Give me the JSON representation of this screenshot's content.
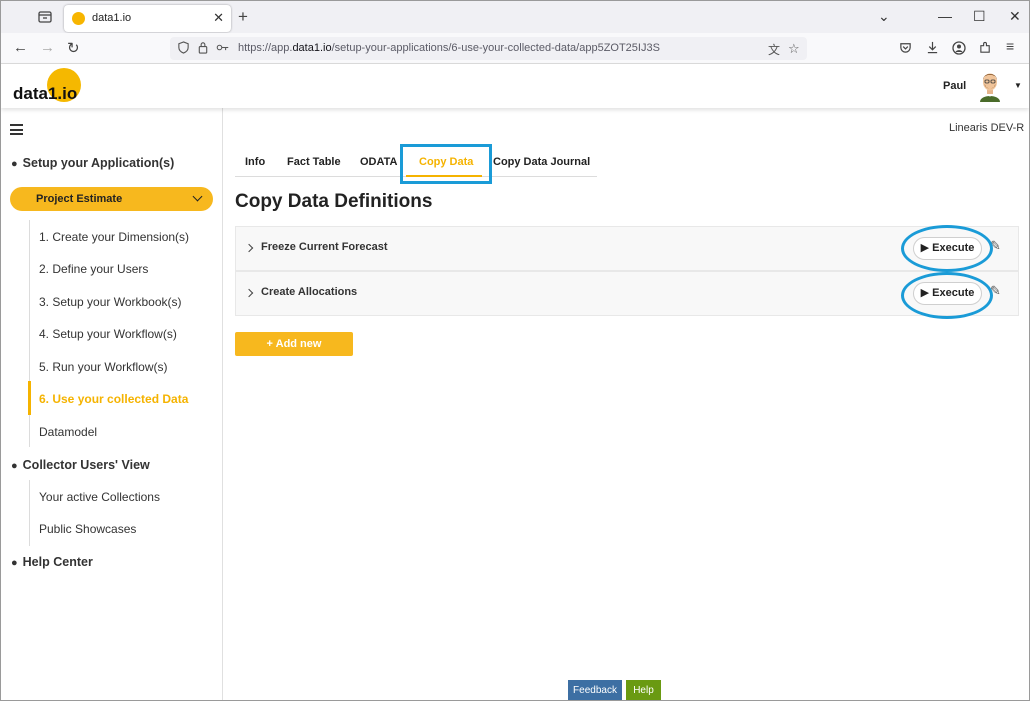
{
  "browser": {
    "tab_title": "data1.io",
    "tab_close": "✕",
    "new_tab": "+",
    "url_prefix": "https://app.",
    "url_domain": "data1.io",
    "url_path": "/setup-your-applications/6-use-your-collected-data/app5ZOT25IJ3S",
    "nav": {
      "back": "←",
      "forward": "→",
      "reload": "↻"
    },
    "window": {
      "minimize": "—",
      "maximize": "☐",
      "close": "✕",
      "dropdown": "⌄"
    }
  },
  "header": {
    "logo_text": "data1.io",
    "user_name": "Paul",
    "user_caret": "▼"
  },
  "sidebar": {
    "sections": [
      {
        "label": "Setup your Application(s)"
      },
      {
        "label": "Collector Users' View"
      },
      {
        "label": "Help Center"
      }
    ],
    "project_selector": "Project Estimate",
    "setup_items": [
      "1. Create your Dimension(s)",
      "2. Define your Users",
      "3. Setup your Workbook(s)",
      "4. Setup your Workflow(s)",
      "5. Run your Workflow(s)",
      "6. Use your collected Data",
      "Datamodel"
    ],
    "collector_items": [
      "Your active Collections",
      "Public Showcases"
    ]
  },
  "main": {
    "environment": "Linearis DEV-R",
    "tabs": [
      "Info",
      "Fact Table",
      "ODATA",
      "Copy Data",
      "Copy Data Journal"
    ],
    "active_tab": "Copy Data",
    "heading": "Copy Data Definitions",
    "rows": [
      {
        "name": "Freeze Current Forecast",
        "action": "▶ Execute"
      },
      {
        "name": "Create Allocations",
        "action": "▶ Execute"
      }
    ],
    "add_new": "+ Add new"
  },
  "footer": {
    "feedback": "Feedback",
    "help": "Help"
  },
  "colors": {
    "accent": "#f5b300",
    "highlight": "#1a9bd7",
    "feedback": "#3d6fa3",
    "help": "#6a9a12"
  }
}
